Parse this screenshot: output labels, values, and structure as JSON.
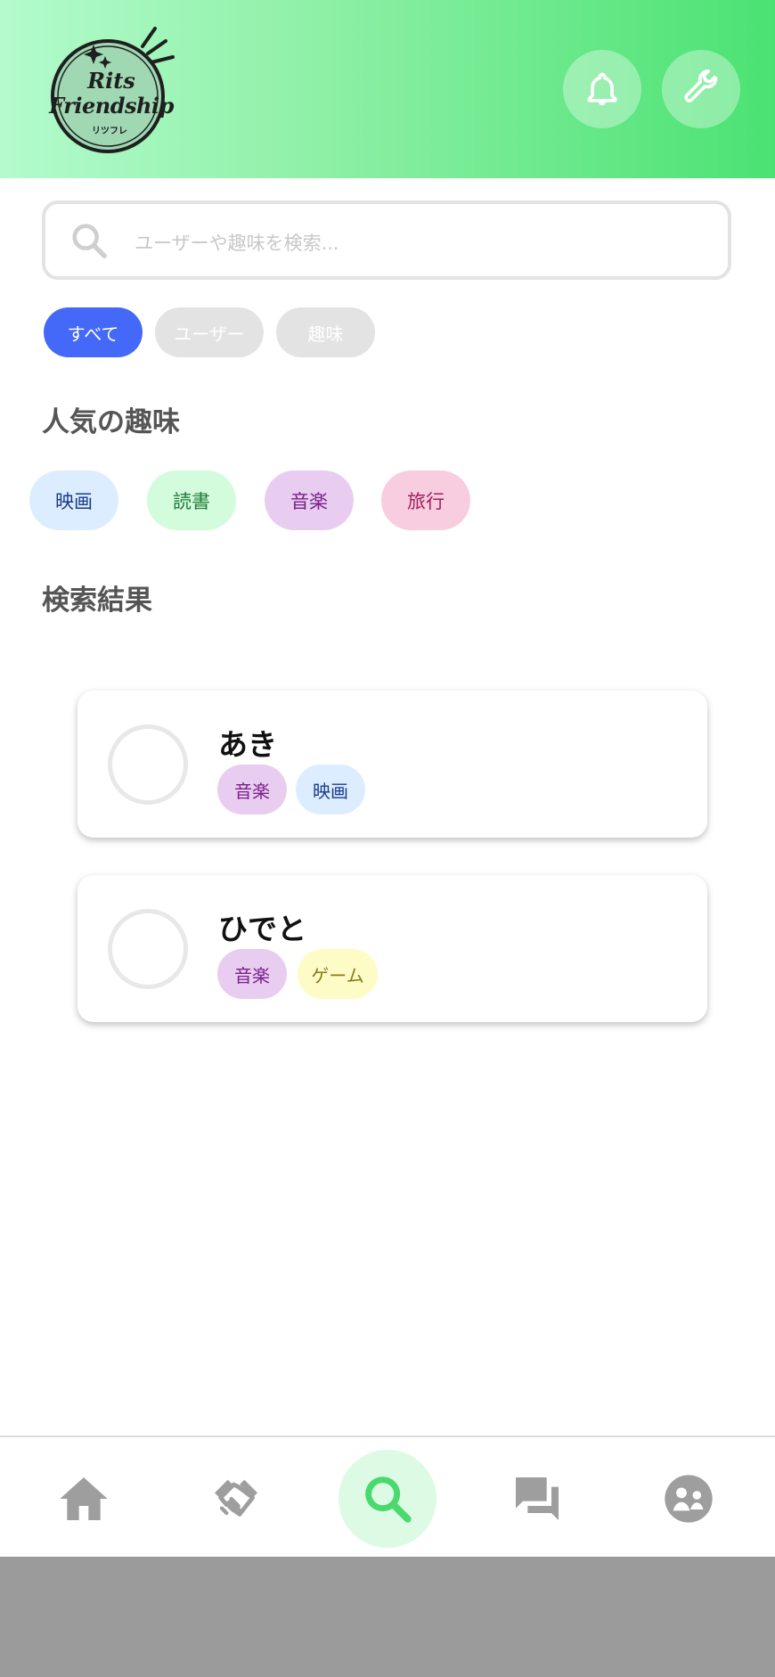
{
  "app": {
    "logo": {
      "line1": "Rits",
      "line2": "Friendship",
      "sub": "リツフレ"
    }
  },
  "colors": {
    "header_gradient_start": "#b3fbcd",
    "header_gradient_end": "#4be273",
    "accent_blue": "#4468f8",
    "active_nav_green": "#49d96d"
  },
  "header": {
    "notification_icon": "bell-icon",
    "settings_icon": "wrench-icon"
  },
  "search": {
    "placeholder": "ユーザーや趣味を検索..."
  },
  "filters": [
    {
      "label": "すべて",
      "selected": true
    },
    {
      "label": "ユーザー",
      "selected": false
    },
    {
      "label": "趣味",
      "selected": false
    }
  ],
  "popular": {
    "title": "人気の趣味",
    "hobbies": [
      {
        "label": "映画",
        "bg": "#dcedff",
        "fg": "#1a3a8a"
      },
      {
        "label": "読書",
        "bg": "#d3fcdc",
        "fg": "#1f7a3a"
      },
      {
        "label": "音楽",
        "bg": "#e8cdf0",
        "fg": "#7a1f8a"
      },
      {
        "label": "旅行",
        "bg": "#f8cde0",
        "fg": "#a01f5a"
      }
    ]
  },
  "results": {
    "title": "検索結果",
    "users": [
      {
        "name": "あき",
        "tags": [
          {
            "label": "音楽",
            "bg": "#e8cdf0",
            "fg": "#7a1f8a"
          },
          {
            "label": "映画",
            "bg": "#dcedff",
            "fg": "#1a3a8a"
          }
        ]
      },
      {
        "name": "ひでと",
        "tags": [
          {
            "label": "音楽",
            "bg": "#e8cdf0",
            "fg": "#7a1f8a"
          },
          {
            "label": "ゲーム",
            "bg": "#fdfcc7",
            "fg": "#8a7a1a"
          }
        ]
      }
    ]
  },
  "bottom_nav": [
    {
      "icon": "home-icon",
      "active": false
    },
    {
      "icon": "handshake-icon",
      "active": false
    },
    {
      "icon": "search-icon",
      "active": true
    },
    {
      "icon": "chat-icon",
      "active": false
    },
    {
      "icon": "community-icon",
      "active": false
    }
  ]
}
